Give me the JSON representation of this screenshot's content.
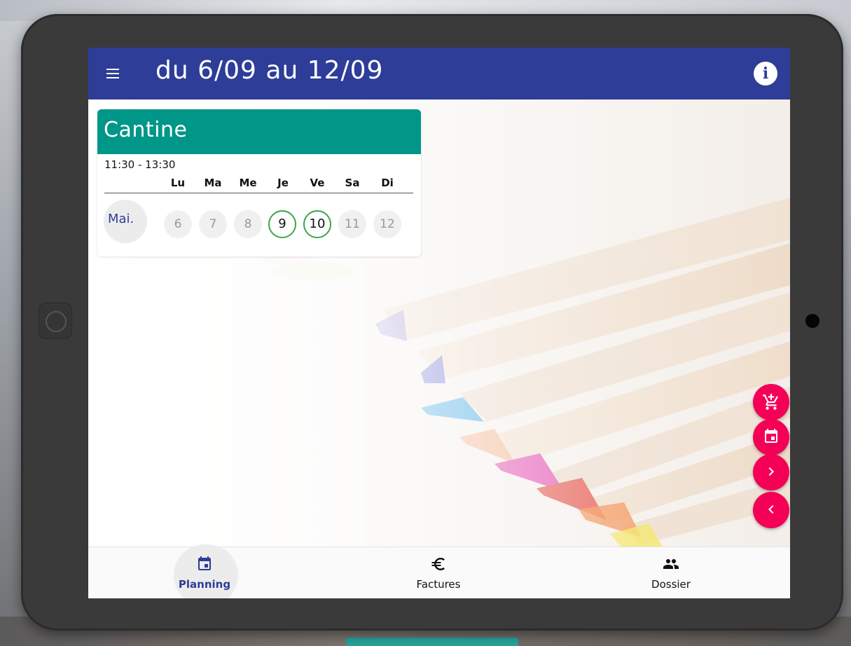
{
  "app_bar": {
    "title": "du 6/09 au 12/09",
    "menu_icon": "menu-icon",
    "info_icon": "info-icon"
  },
  "card": {
    "title": "Cantine",
    "time": "11:30 - 13:30",
    "day_headers": [
      "Lu",
      "Ma",
      "Me",
      "Je",
      "Ve",
      "Sa",
      "Di"
    ],
    "row_label": "Mai.",
    "days": [
      {
        "num": "6",
        "state": "inactive"
      },
      {
        "num": "7",
        "state": "inactive"
      },
      {
        "num": "8",
        "state": "inactive"
      },
      {
        "num": "9",
        "state": "selected"
      },
      {
        "num": "10",
        "state": "selected"
      },
      {
        "num": "11",
        "state": "inactive"
      },
      {
        "num": "12",
        "state": "inactive"
      }
    ]
  },
  "fabs": [
    "add-to-cart-icon",
    "calendar-icon",
    "chevron-right-icon",
    "chevron-left-icon"
  ],
  "bottom_nav": {
    "items": [
      {
        "label": "Planning",
        "icon": "calendar-icon",
        "active": true
      },
      {
        "label": "Factures",
        "icon": "euro-icon",
        "active": false
      },
      {
        "label": "Dossier",
        "icon": "people-icon",
        "active": false
      }
    ]
  },
  "colors": {
    "primary": "#2e3d98",
    "card_header": "#009688",
    "fab": "#f50057",
    "selected_ring": "#3fa34d",
    "frame": "#3a3a3a"
  }
}
